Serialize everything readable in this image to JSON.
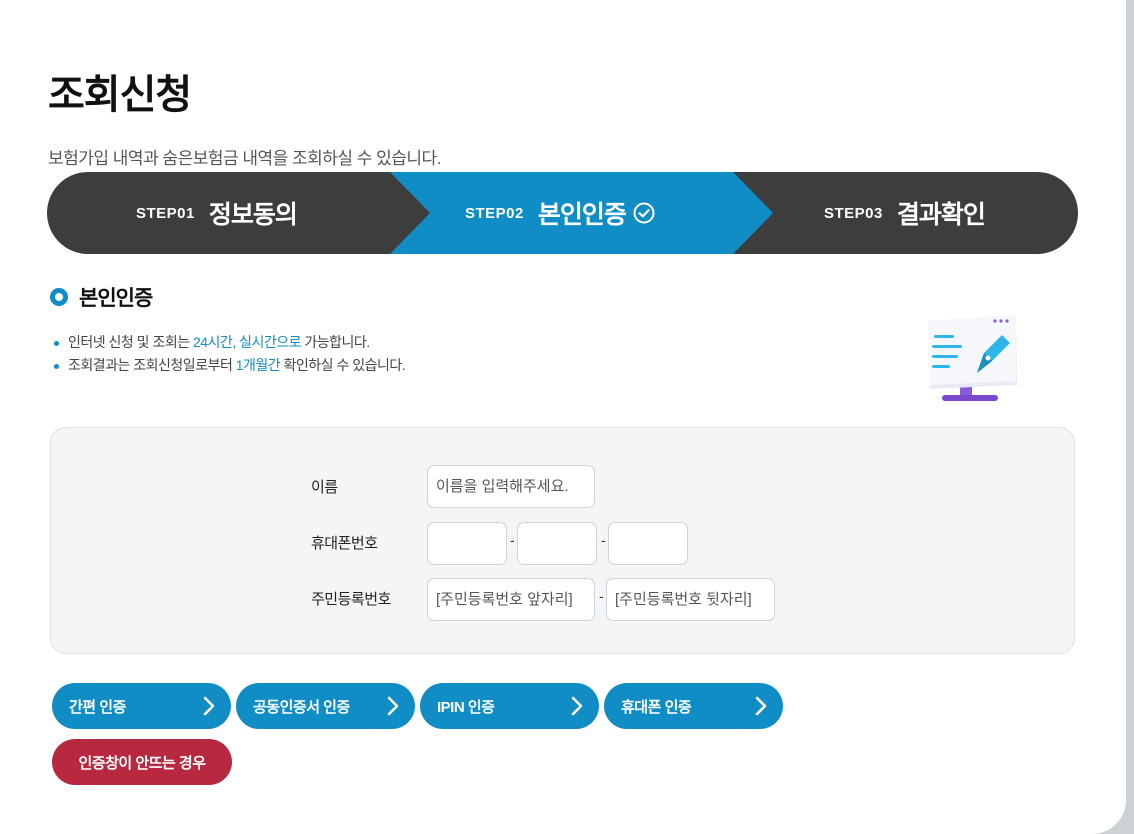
{
  "page": {
    "title": "조회신청",
    "subtitle": "보험가입 내역과 숨은보험금 내역을 조회하실 수 있습니다."
  },
  "steps": [
    {
      "num": "STEP01",
      "label": "정보동의",
      "active": false
    },
    {
      "num": "STEP02",
      "label": "본인인증",
      "active": true
    },
    {
      "num": "STEP03",
      "label": "결과확인",
      "active": false
    }
  ],
  "section": {
    "title": "본인인증",
    "notes": [
      {
        "pre": "인터넷 신청 및 조회는 ",
        "hl": "24시간, 실시간으로",
        "post": " 가능합니다."
      },
      {
        "pre": "조회결과는 조회신청일로부터 ",
        "hl": "1개월간",
        "post": " 확인하실 수 있습니다."
      }
    ]
  },
  "form": {
    "name_label": "이름",
    "name_placeholder": "이름을 입력해주세요.",
    "phone_label": "휴대폰번호",
    "phone_sep": "-",
    "rrn_label": "주민등록번호",
    "rrn_front_placeholder": "[주민등록번호 앞자리]",
    "rrn_back_placeholder": "[주민등록번호 뒷자리]",
    "rrn_sep": "-"
  },
  "buttons": {
    "simple": "간편 인증",
    "cert": "공동인증서 인증",
    "ipin": "IPIN 인증",
    "phone": "휴대폰 인증",
    "popup_help": "인증창이 안뜨는 경우"
  },
  "colors": {
    "accent": "#0f8dc4",
    "dark": "#3d3d3d",
    "danger": "#b8283f"
  }
}
